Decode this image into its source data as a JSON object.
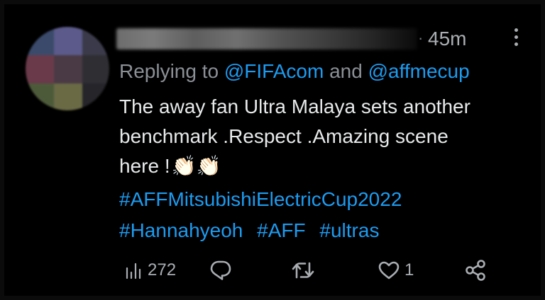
{
  "tweet": {
    "time": "45m",
    "separator": "·",
    "replying": {
      "prefix": "Replying to",
      "mention1": "@FIFAcom",
      "conjunction": "and",
      "mention2": "@affmecup"
    },
    "body_lines": [
      "The away fan Ultra Malaya sets another",
      "benchmark .Respect .Amazing scene",
      "here !"
    ],
    "emoji": "👏🏻👏🏻",
    "hashtags_line1": "#AFFMitsubishiElectricCup2022",
    "hashtags_line2": [
      "#Hannahyeoh",
      "#AFF",
      "#ultras"
    ]
  },
  "actions": {
    "views_count": "272",
    "likes_count": "1",
    "icons": [
      "views-icon",
      "reply-icon",
      "retweet-icon",
      "like-icon",
      "share-icon"
    ]
  },
  "colors": {
    "background": "#000000",
    "text": "#e7e9ea",
    "secondary": "#8b9096",
    "link": "#1d9bf0"
  }
}
